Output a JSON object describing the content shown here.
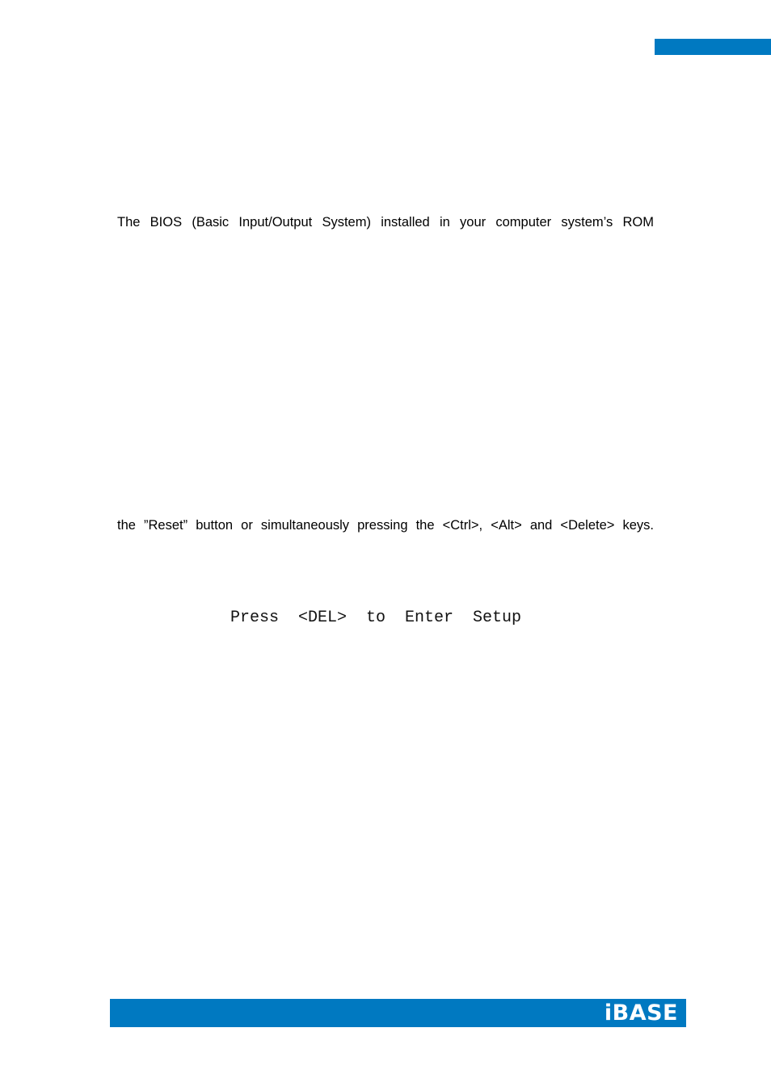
{
  "page": {
    "accent_color": "#0079c1",
    "background_color": "#ffffff"
  },
  "body_text": {
    "line_1": "The BIOS (Basic Input/Output System) installed in your computer system’s ROM",
    "line_2": "the ”Reset” button or simultaneously pressing the <Ctrl>, <Alt> and <Delete> keys."
  },
  "bios_prompt": {
    "text": "Press  <DEL>  to  Enter  Setup"
  },
  "footer": {
    "logo_text": "iBASE"
  }
}
